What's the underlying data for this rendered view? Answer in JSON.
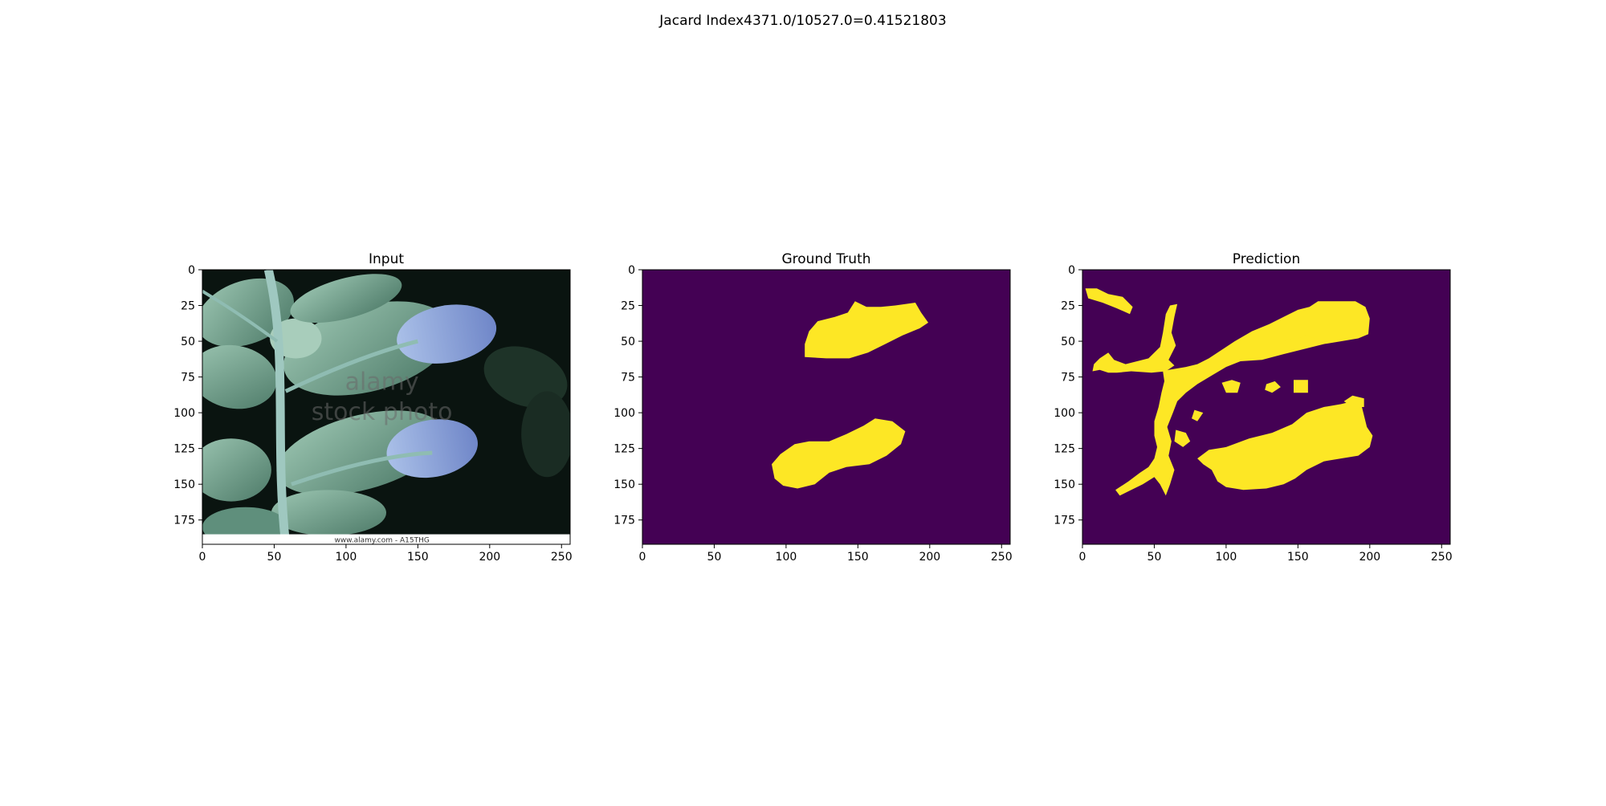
{
  "figure": {
    "suptitle": "Jacard Index4371.0/10527.0=0.41521803"
  },
  "colors": {
    "mask_background": "#440154",
    "mask_foreground": "#fde725",
    "leaf_dark": "#0a1410",
    "leaf_green": "#7fae9e",
    "leaf_blue": "#8fa6d8"
  },
  "chart_data": [
    {
      "type": "image",
      "title": "Input",
      "xlim": [
        0,
        256
      ],
      "ylim": [
        192,
        0
      ],
      "xticks": [
        0,
        50,
        100,
        150,
        200,
        250
      ],
      "yticks": [
        0,
        25,
        50,
        75,
        100,
        125,
        150,
        175
      ],
      "content": "leaf-photo",
      "watermark_lines": [
        "alamy",
        "stock photo"
      ],
      "footer_text": "www.alamy.com - A15THG"
    },
    {
      "type": "image",
      "title": "Ground Truth",
      "xlim": [
        0,
        256
      ],
      "ylim": [
        192,
        0
      ],
      "xticks": [
        0,
        50,
        100,
        150,
        200,
        250
      ],
      "yticks": [
        0,
        25,
        50,
        75,
        100,
        125,
        150,
        175
      ],
      "content": "mask",
      "regions": [
        [
          [
            116,
            43
          ],
          [
            122,
            36
          ],
          [
            134,
            33
          ],
          [
            143,
            30
          ],
          [
            148,
            22
          ],
          [
            156,
            26
          ],
          [
            166,
            26
          ],
          [
            176,
            25
          ],
          [
            190,
            23
          ],
          [
            194,
            30
          ],
          [
            199,
            37
          ],
          [
            193,
            41
          ],
          [
            181,
            46
          ],
          [
            169,
            52
          ],
          [
            157,
            58
          ],
          [
            144,
            62
          ],
          [
            128,
            62
          ],
          [
            113,
            61
          ],
          [
            113,
            52
          ]
        ],
        [
          [
            90,
            136
          ],
          [
            96,
            129
          ],
          [
            106,
            122
          ],
          [
            116,
            120
          ],
          [
            130,
            120
          ],
          [
            142,
            115
          ],
          [
            154,
            109
          ],
          [
            162,
            104
          ],
          [
            174,
            106
          ],
          [
            183,
            113
          ],
          [
            180,
            122
          ],
          [
            170,
            130
          ],
          [
            158,
            136
          ],
          [
            142,
            138
          ],
          [
            130,
            142
          ],
          [
            120,
            150
          ],
          [
            108,
            153
          ],
          [
            98,
            151
          ],
          [
            92,
            146
          ]
        ]
      ]
    },
    {
      "type": "image",
      "title": "Prediction",
      "xlim": [
        0,
        256
      ],
      "ylim": [
        192,
        0
      ],
      "xticks": [
        0,
        50,
        100,
        150,
        200,
        250
      ],
      "yticks": [
        0,
        25,
        50,
        75,
        100,
        125,
        150,
        175
      ],
      "content": "mask",
      "regions": [
        [
          [
            2,
            13
          ],
          [
            10,
            13
          ],
          [
            18,
            17
          ],
          [
            28,
            19
          ],
          [
            35,
            26
          ],
          [
            33,
            31
          ],
          [
            24,
            27
          ],
          [
            14,
            23
          ],
          [
            4,
            20
          ]
        ],
        [
          [
            58,
            31
          ],
          [
            61,
            25
          ],
          [
            66,
            24
          ],
          [
            64,
            33
          ],
          [
            62,
            44
          ],
          [
            65,
            53
          ],
          [
            60,
            63
          ],
          [
            64,
            67
          ],
          [
            58,
            71
          ],
          [
            48,
            72
          ],
          [
            34,
            71
          ],
          [
            24,
            72
          ],
          [
            18,
            72
          ],
          [
            12,
            70
          ],
          [
            7,
            71
          ],
          [
            8,
            66
          ],
          [
            12,
            62
          ],
          [
            18,
            58
          ],
          [
            22,
            63
          ],
          [
            30,
            66
          ],
          [
            38,
            64
          ],
          [
            46,
            62
          ],
          [
            54,
            54
          ],
          [
            56,
            44
          ]
        ],
        [
          [
            56,
            71
          ],
          [
            60,
            70
          ],
          [
            72,
            68
          ],
          [
            80,
            66
          ],
          [
            88,
            62
          ],
          [
            97,
            56
          ],
          [
            106,
            50
          ],
          [
            118,
            43
          ],
          [
            130,
            38
          ],
          [
            142,
            32
          ],
          [
            150,
            28
          ],
          [
            158,
            26
          ],
          [
            164,
            22
          ],
          [
            175,
            22
          ],
          [
            190,
            22
          ],
          [
            197,
            26
          ],
          [
            200,
            34
          ],
          [
            199,
            45
          ],
          [
            192,
            48
          ],
          [
            180,
            50
          ],
          [
            168,
            52
          ],
          [
            156,
            55
          ],
          [
            140,
            59
          ],
          [
            125,
            63
          ],
          [
            110,
            64
          ],
          [
            100,
            68
          ],
          [
            90,
            74
          ],
          [
            80,
            80
          ],
          [
            72,
            86
          ],
          [
            66,
            92
          ],
          [
            63,
            100
          ],
          [
            59,
            110
          ],
          [
            62,
            120
          ],
          [
            60,
            130
          ],
          [
            64,
            140
          ],
          [
            61,
            150
          ],
          [
            58,
            158
          ],
          [
            54,
            150
          ],
          [
            50,
            145
          ],
          [
            42,
            150
          ],
          [
            34,
            154
          ],
          [
            26,
            158
          ],
          [
            23,
            154
          ],
          [
            32,
            148
          ],
          [
            40,
            142
          ],
          [
            46,
            138
          ],
          [
            50,
            132
          ],
          [
            52,
            124
          ],
          [
            50,
            116
          ],
          [
            50,
            106
          ],
          [
            53,
            96
          ],
          [
            55,
            86
          ],
          [
            57,
            78
          ]
        ],
        [
          [
            150,
            48
          ],
          [
            156,
            46
          ],
          [
            162,
            48
          ],
          [
            160,
            52
          ],
          [
            152,
            52
          ]
        ],
        [
          [
            140,
            50
          ],
          [
            146,
            48
          ],
          [
            150,
            52
          ],
          [
            144,
            54
          ]
        ],
        [
          [
            97,
            79
          ],
          [
            104,
            77
          ],
          [
            110,
            79
          ],
          [
            108,
            86
          ],
          [
            100,
            86
          ]
        ],
        [
          [
            128,
            80
          ],
          [
            134,
            78
          ],
          [
            138,
            82
          ],
          [
            132,
            86
          ],
          [
            127,
            84
          ]
        ],
        [
          [
            147,
            77
          ],
          [
            157,
            77
          ],
          [
            157,
            86
          ],
          [
            147,
            86
          ]
        ],
        [
          [
            78,
            98
          ],
          [
            84,
            100
          ],
          [
            80,
            106
          ],
          [
            76,
            104
          ]
        ],
        [
          [
            65,
            112
          ],
          [
            72,
            114
          ],
          [
            75,
            120
          ],
          [
            70,
            124
          ],
          [
            64,
            120
          ]
        ],
        [
          [
            80,
            132
          ],
          [
            88,
            126
          ],
          [
            100,
            124
          ],
          [
            116,
            118
          ],
          [
            132,
            114
          ],
          [
            146,
            108
          ],
          [
            156,
            100
          ],
          [
            168,
            96
          ],
          [
            180,
            94
          ],
          [
            188,
            92
          ],
          [
            194,
            94
          ],
          [
            196,
            102
          ],
          [
            198,
            110
          ],
          [
            202,
            116
          ],
          [
            200,
            124
          ],
          [
            192,
            130
          ],
          [
            180,
            132
          ],
          [
            168,
            134
          ],
          [
            156,
            140
          ],
          [
            148,
            146
          ],
          [
            140,
            150
          ],
          [
            128,
            153
          ],
          [
            112,
            154
          ],
          [
            100,
            152
          ],
          [
            94,
            148
          ],
          [
            90,
            140
          ],
          [
            84,
            136
          ]
        ],
        [
          [
            182,
            92
          ],
          [
            188,
            88
          ],
          [
            196,
            90
          ],
          [
            196,
            96
          ],
          [
            188,
            96
          ]
        ]
      ]
    }
  ]
}
